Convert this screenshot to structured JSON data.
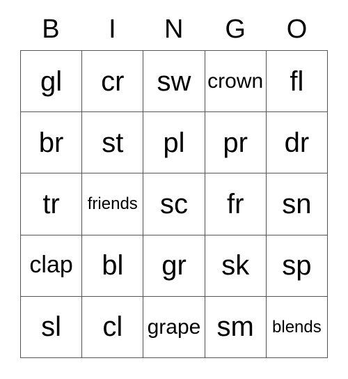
{
  "card": {
    "title": "BINGO",
    "header": {
      "letters": [
        "B",
        "I",
        "N",
        "G",
        "O"
      ]
    },
    "grid": {
      "rows": 5,
      "columns": 5,
      "border_color": "#555555",
      "background_color": "#ffffff",
      "text_color": "#000000",
      "cells": [
        [
          {
            "label": "gl",
            "marked": false
          },
          {
            "label": "cr",
            "marked": false
          },
          {
            "label": "sw",
            "marked": false
          },
          {
            "label": "crown",
            "marked": false
          },
          {
            "label": "fl",
            "marked": false
          }
        ],
        [
          {
            "label": "br",
            "marked": false
          },
          {
            "label": "st",
            "marked": false
          },
          {
            "label": "pl",
            "marked": false
          },
          {
            "label": "pr",
            "marked": false
          },
          {
            "label": "dr",
            "marked": false
          }
        ],
        [
          {
            "label": "tr",
            "marked": false
          },
          {
            "label": "friends",
            "marked": false
          },
          {
            "label": "sc",
            "marked": false
          },
          {
            "label": "fr",
            "marked": false
          },
          {
            "label": "sn",
            "marked": false
          }
        ],
        [
          {
            "label": "clap",
            "marked": false
          },
          {
            "label": "bl",
            "marked": false
          },
          {
            "label": "gr",
            "marked": false
          },
          {
            "label": "sk",
            "marked": false
          },
          {
            "label": "sp",
            "marked": false
          }
        ],
        [
          {
            "label": "sl",
            "marked": false
          },
          {
            "label": "cl",
            "marked": false
          },
          {
            "label": "grape",
            "marked": false
          },
          {
            "label": "sm",
            "marked": false
          },
          {
            "label": "blends",
            "marked": false
          }
        ]
      ]
    }
  }
}
